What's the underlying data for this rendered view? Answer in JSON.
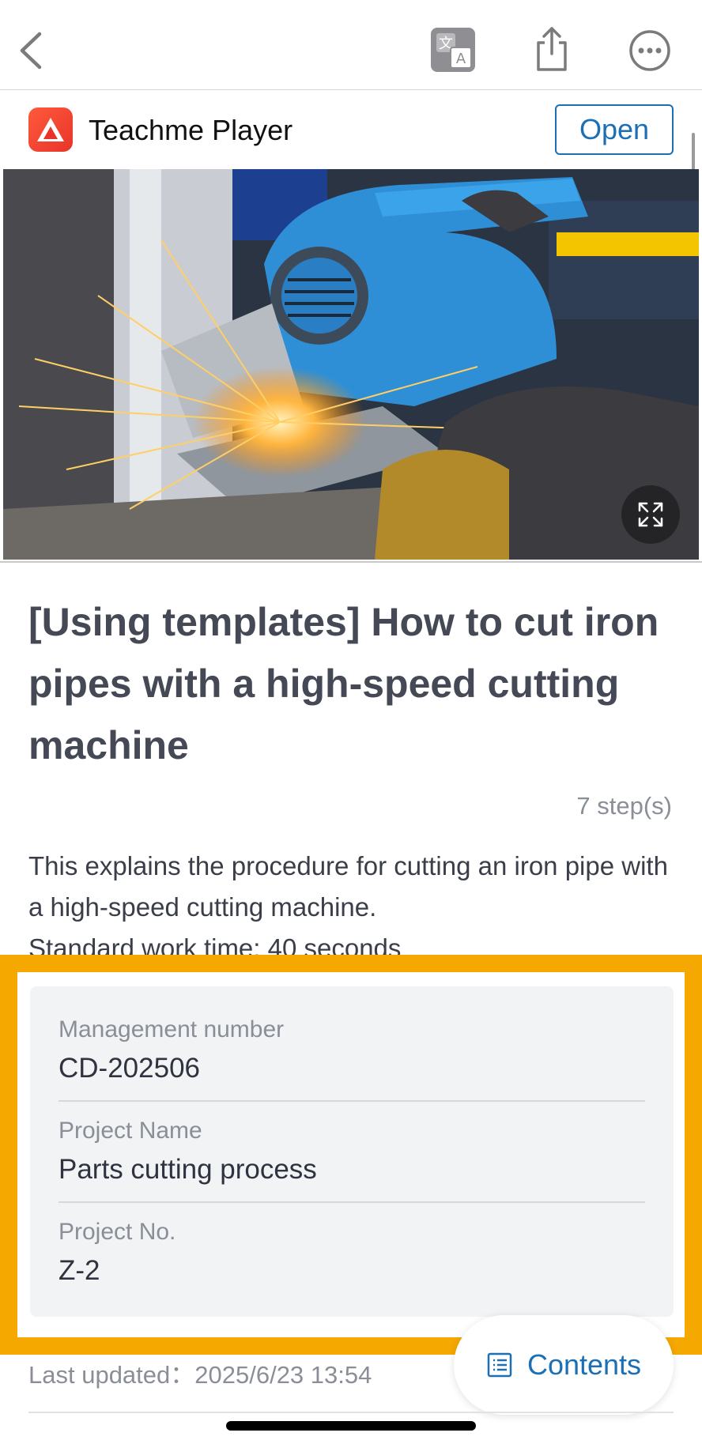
{
  "navbar": {
    "back_icon": "chevron-left-icon",
    "translate_icon": "translate-icon",
    "share_icon": "share-icon",
    "more_icon": "ellipsis-icon"
  },
  "app_banner": {
    "app_name": "Teachme Player",
    "open_label": "Open"
  },
  "video": {
    "expand_icon": "fullscreen-icon"
  },
  "article": {
    "title": "[Using templates] How to cut iron pipes with a high-speed cutting machine",
    "step_count": "7 step(s)",
    "description_line1": "This explains the procedure for cutting an iron pipe with a high-speed cutting machine.",
    "description_line2": "Standard work time: 40 seconds"
  },
  "info": {
    "fields": [
      {
        "label": "Management number",
        "value": "CD-202506"
      },
      {
        "label": "Project Name",
        "value": "Parts cutting process"
      },
      {
        "label": "Project No.",
        "value": "Z-2"
      }
    ]
  },
  "footer": {
    "last_updated": "Last updated：2025/6/23 13:54",
    "contents_label": "Contents"
  },
  "colors": {
    "accent": "#1a6fb5",
    "highlight": "#f5a800",
    "title": "#444955"
  }
}
